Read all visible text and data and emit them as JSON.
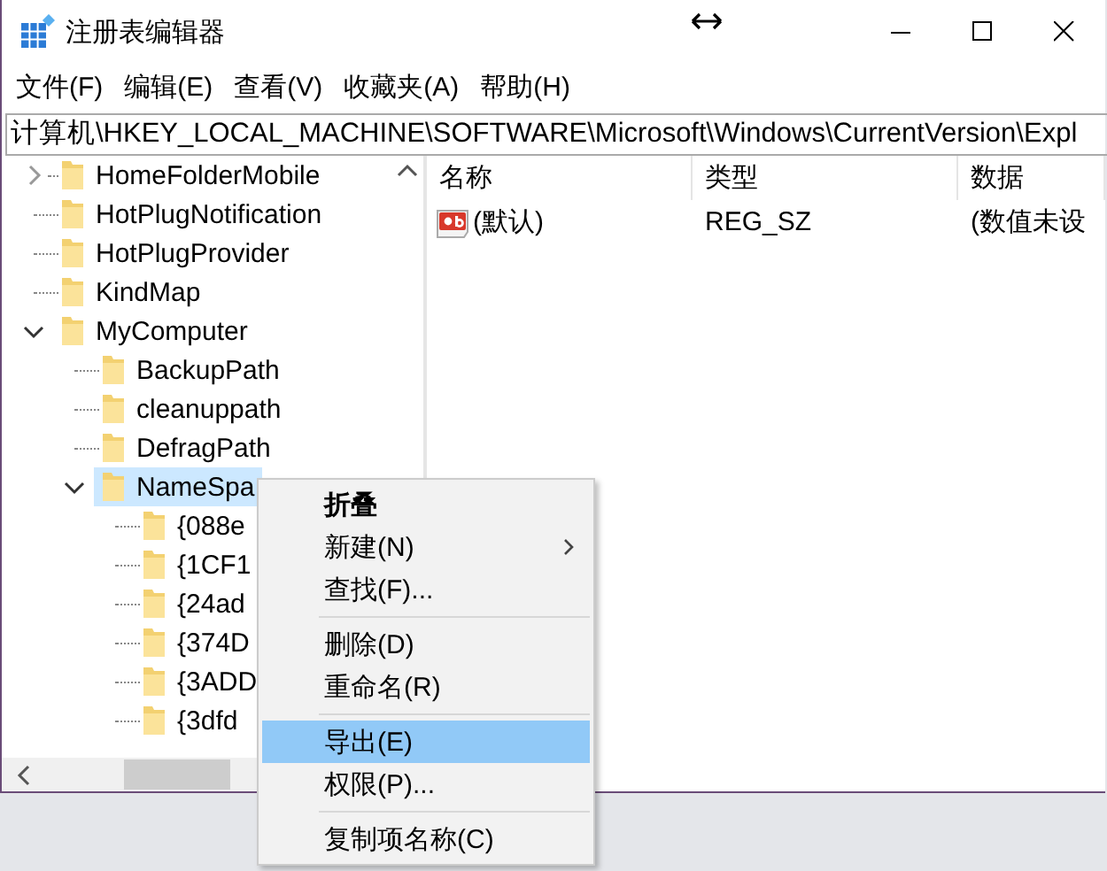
{
  "window": {
    "title": "注册表编辑器"
  },
  "menu_bar": [
    "文件(F)",
    "编辑(E)",
    "查看(V)",
    "收藏夹(A)",
    "帮助(H)"
  ],
  "address": "计算机\\HKEY_LOCAL_MACHINE\\SOFTWARE\\Microsoft\\Windows\\CurrentVersion\\Expl",
  "tree": [
    {
      "label": "HomeFolderMobile",
      "expandable": true,
      "expanded": false,
      "selected": false
    },
    {
      "label": "HotPlugNotification",
      "expandable": false,
      "selected": false
    },
    {
      "label": "HotPlugProvider",
      "expandable": false,
      "selected": false
    },
    {
      "label": "KindMap",
      "expandable": false,
      "selected": false
    },
    {
      "label": "MyComputer",
      "expandable": true,
      "expanded": true,
      "selected": false,
      "children": [
        {
          "label": "BackupPath",
          "expandable": false,
          "selected": false
        },
        {
          "label": "cleanuppath",
          "expandable": false,
          "selected": false
        },
        {
          "label": "DefragPath",
          "expandable": false,
          "selected": false
        },
        {
          "label": "NameSpa",
          "expandable": true,
          "expanded": true,
          "selected": true,
          "children": [
            {
              "label": "{088e",
              "expandable": false,
              "selected": false
            },
            {
              "label": "{1CF1",
              "expandable": false,
              "selected": false
            },
            {
              "label": "{24ad",
              "expandable": false,
              "selected": false
            },
            {
              "label": "{374D",
              "expandable": false,
              "selected": false
            },
            {
              "label": "{3ADD",
              "expandable": false,
              "selected": false
            },
            {
              "label": "{3dfd",
              "expandable": false,
              "selected": false
            }
          ]
        }
      ]
    }
  ],
  "values": {
    "columns": [
      "名称",
      "类型",
      "数据"
    ],
    "rows": [
      {
        "name": "(默认)",
        "type": "REG_SZ",
        "data": "(数值未设"
      }
    ]
  },
  "context_menu": [
    {
      "kind": "item",
      "label": "折叠",
      "default": true,
      "submenu": false,
      "selected": false
    },
    {
      "kind": "item",
      "label": "新建(N)",
      "default": false,
      "submenu": true,
      "selected": false
    },
    {
      "kind": "item",
      "label": "查找(F)...",
      "default": false,
      "submenu": false,
      "selected": false
    },
    {
      "kind": "separator"
    },
    {
      "kind": "item",
      "label": "删除(D)",
      "default": false,
      "submenu": false,
      "selected": false
    },
    {
      "kind": "item",
      "label": "重命名(R)",
      "default": false,
      "submenu": false,
      "selected": false
    },
    {
      "kind": "separator"
    },
    {
      "kind": "item",
      "label": "导出(E)",
      "default": false,
      "submenu": false,
      "selected": true
    },
    {
      "kind": "item",
      "label": "权限(P)...",
      "default": false,
      "submenu": false,
      "selected": false
    },
    {
      "kind": "separator"
    },
    {
      "kind": "item",
      "label": "复制项名称(C)",
      "default": false,
      "submenu": false,
      "selected": false
    }
  ]
}
